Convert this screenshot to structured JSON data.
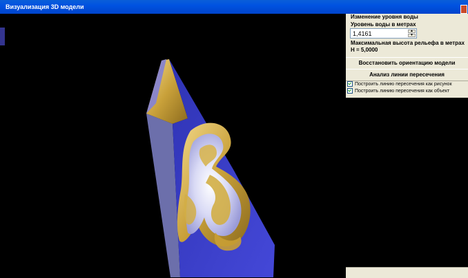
{
  "window": {
    "title": "Визуализация 3D модели"
  },
  "panel": {
    "water_section": "Изменение уровня воды",
    "water_label": "Уровень воды в метрах",
    "water_value": "1,4161",
    "max_label": "Максимальная высота рельефа в метрах",
    "max_value": "H = 5,0000",
    "restore_button": "Восстановить ориентацию модели",
    "analysis_button": "Анализ линии пересечения",
    "checkbox_1": "Построить линию пересечения как рисунок",
    "checkbox_2": "Построить линию пересечения как объект"
  },
  "colors": {
    "title_bar": "#0052e0",
    "model_blue": "#3a3ec8",
    "model_gold": "#c9a93a",
    "background": "#000000"
  }
}
